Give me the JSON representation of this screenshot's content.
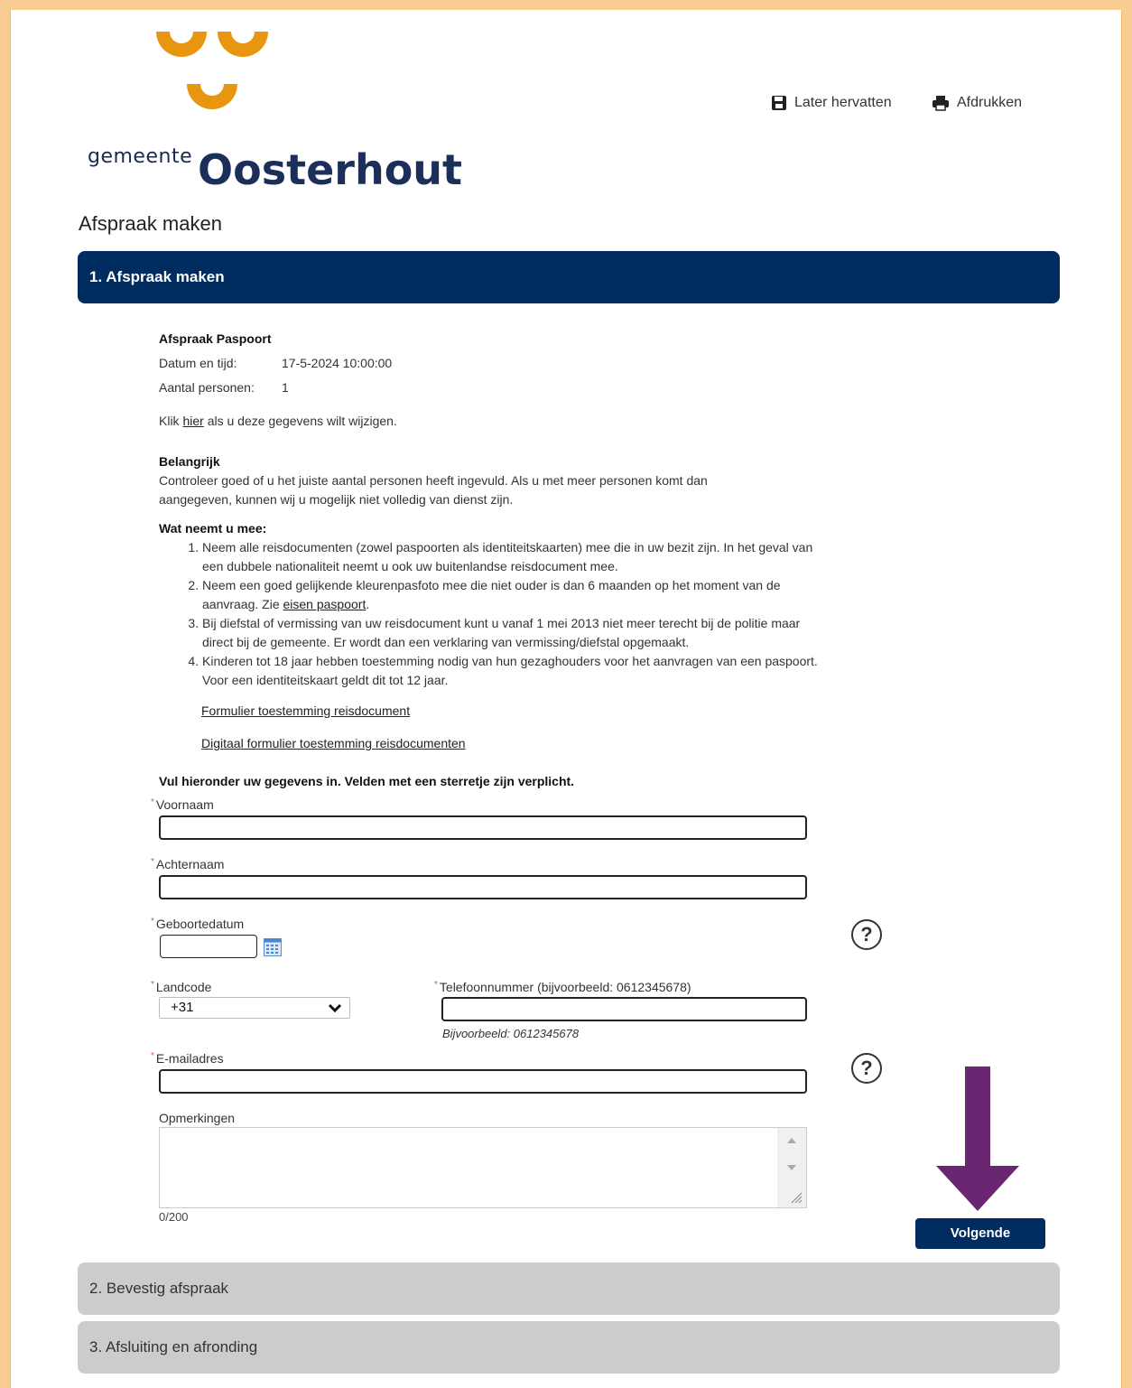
{
  "logo": {
    "prefix": "gemeente",
    "name": "Oosterhout",
    "color": "#e8960f"
  },
  "toolbar": {
    "resume_label": "Later hervatten",
    "print_label": "Afdrukken"
  },
  "page_title": "Afspraak maken",
  "steps": [
    {
      "label": "1. Afspraak maken",
      "state": "active"
    },
    {
      "label": "2. Bevestig afspraak",
      "state": "inactive"
    },
    {
      "label": "3. Afsluiting en afronding",
      "state": "inactive"
    }
  ],
  "summary": {
    "title": "Afspraak Paspoort",
    "datetime_label": "Datum en tijd:",
    "datetime_value": "17-5-2024 10:00:00",
    "persons_label": "Aantal personen:",
    "persons_value": "1",
    "change_prefix": "Klik",
    "change_link": "hier",
    "change_suffix": "als u deze gegevens wilt wijzigen."
  },
  "important": {
    "title": "Belangrijk",
    "text": "Controleer goed of u het juiste aantal personen heeft ingevuld. Als u met meer personen komt dan aangegeven, kunnen wij u mogelijk niet volledig van dienst zijn."
  },
  "bring": {
    "title": "Wat neemt u mee:",
    "item1": "Neem alle reisdocumenten (zowel paspoorten als identiteitskaarten) mee die in uw bezit zijn. In het geval van een dubbele nationaliteit neemt u ook uw buitenlandse reisdocument mee.",
    "item2_before": "Neem een goed gelijkende kleurenpasfoto mee die niet ouder is dan 6 maanden op het moment van de aanvraag. Zie",
    "item2_link": "eisen paspoort",
    "item2_after": ".",
    "item3": "Bij diefstal of vermissing van uw reisdocument kunt u vanaf 1 mei 2013 niet meer terecht bij de politie maar direct bij de gemeente. Er wordt dan een verklaring van vermissing/diefstal opgemaakt.",
    "item4": "Kinderen tot 18 jaar hebben toestemming nodig van hun gezaghouders voor het aanvragen van een paspoort. Voor een identiteitskaart geldt dit tot 12 jaar.",
    "link1": "Formulier toestemming reisdocument",
    "link2": "Digitaal formulier toestemming reisdocumenten"
  },
  "form": {
    "intro": "Vul hieronder uw gegevens in. Velden met een sterretje zijn verplicht.",
    "required_mark": "*",
    "first_name_label": "Voornaam",
    "last_name_label": "Achternaam",
    "birthdate_label": "Geboortedatum",
    "country_code_label": "Landcode",
    "country_code_value": "+31",
    "phone_label": "Telefoonnummer (bijvoorbeeld: 0612345678)",
    "phone_example": "Bijvoorbeeld: 0612345678",
    "email_label": "E-mailadres",
    "remarks_label": "Opmerkingen",
    "remarks_counter": "0/200",
    "help_glyph": "?",
    "next_label": "Volgende"
  },
  "annotation": {
    "arrow_color": "#6a2670"
  }
}
